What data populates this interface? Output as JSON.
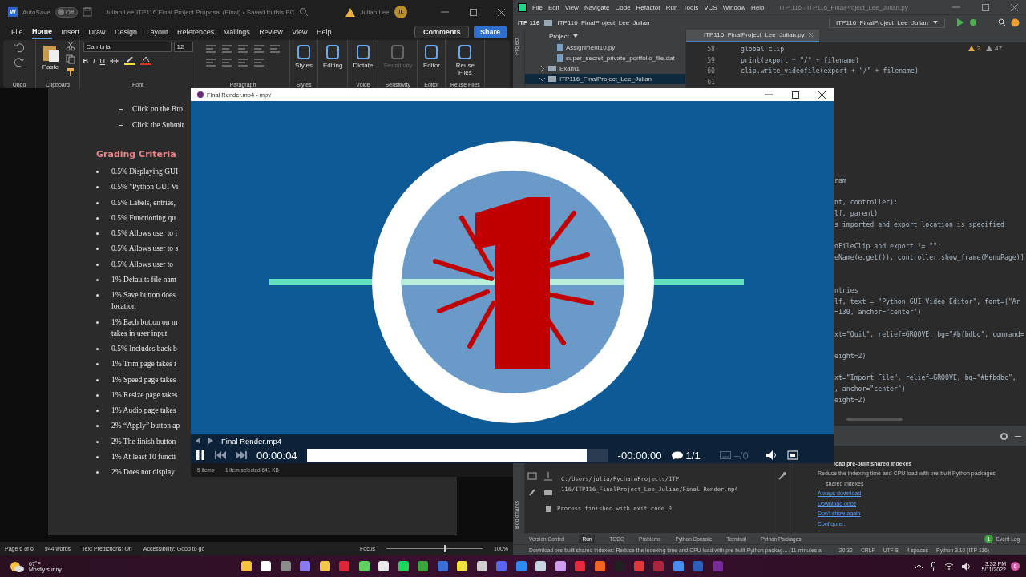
{
  "word": {
    "title_bar": {
      "app_letter": "W",
      "autosave_label": "AutoSave",
      "autosave": {
        "on": false,
        "label": "Off"
      },
      "document_title": "Julian Lee ITP116 Final Project Proposal (Final) • Saved to this PC",
      "user_name": "Julian Lee",
      "avatar_initials": "JL"
    },
    "tabs": [
      {
        "label": "File",
        "selected": false
      },
      {
        "label": "Home",
        "selected": true
      },
      {
        "label": "Insert",
        "selected": false
      },
      {
        "label": "Draw",
        "selected": false
      },
      {
        "label": "Design",
        "selected": false
      },
      {
        "label": "Layout",
        "selected": false
      },
      {
        "label": "References",
        "selected": false
      },
      {
        "label": "Mailings",
        "selected": false
      },
      {
        "label": "Review",
        "selected": false
      },
      {
        "label": "View",
        "selected": false
      },
      {
        "label": "Help",
        "selected": false
      }
    ],
    "comments_button": "Comments",
    "share_button": "Share",
    "ribbon": [
      {
        "kind": "undo",
        "label": "Undo"
      },
      {
        "kind": "clipboard",
        "label": "Clipboard",
        "button": {
          "label": "Paste",
          "disabled": false
        }
      },
      {
        "kind": "font",
        "label": "Font",
        "font_name": "Cambria",
        "font_size": "12",
        "format_buttons": [
          "B",
          "I",
          "U"
        ]
      },
      {
        "kind": "paragraph",
        "label": "Paragraph"
      },
      {
        "kind": "big",
        "label": "Styles",
        "button": {
          "label": "Styles",
          "disabled": false
        }
      },
      {
        "kind": "big",
        "button": {
          "label": "Editing",
          "disabled": false
        }
      },
      {
        "kind": "big",
        "label": "Voice",
        "button": {
          "label": "Dictate",
          "disabled": false
        }
      },
      {
        "kind": "big",
        "label": "Sensitivity",
        "button": {
          "label": "Sensitivity",
          "disabled": true
        }
      },
      {
        "kind": "big",
        "label": "Editor",
        "button": {
          "label": "Editor",
          "disabled": false
        }
      },
      {
        "kind": "big",
        "label": "Reuse Files",
        "button": {
          "label": "Reuse Files",
          "disabled": false
        }
      }
    ],
    "document": {
      "sub_items": [
        "Click on the Bro",
        "Click the Submit"
      ],
      "heading": "Grading Criteria",
      "criteria": [
        {
          "lines": [
            "0.5% Displaying GUI"
          ]
        },
        {
          "lines": [
            "0.5% \"Python GUI Vi"
          ]
        },
        {
          "lines": [
            "0.5% Labels, entries,"
          ]
        },
        {
          "lines": [
            "0.5% Functioning qu"
          ]
        },
        {
          "lines": [
            "0.5% Allows user to i"
          ]
        },
        {
          "lines": [
            "0.5% Allows user to s"
          ]
        },
        {
          "lines": [
            "0.5% Allows user to"
          ]
        },
        {
          "lines": [
            "1% Defaults file nam"
          ]
        },
        {
          "lines": [
            "1% Save button does",
            "location"
          ]
        },
        {
          "lines": [
            "1% Each button on m",
            "takes in user input"
          ]
        },
        {
          "lines": [
            "0.5% Includes back b"
          ]
        },
        {
          "lines": [
            "1% Trim page takes i"
          ]
        },
        {
          "lines": [
            "1% Speed page takes"
          ]
        },
        {
          "lines": [
            "1% Resize page takes"
          ]
        },
        {
          "lines": [
            "1% Audio page takes"
          ]
        },
        {
          "lines": [
            "2% “Apply” button ap"
          ]
        },
        {
          "lines": [
            "2% The finish button"
          ]
        },
        {
          "lines": [
            "1% At least 10 functi"
          ]
        },
        {
          "lines": [
            "2% Does not display"
          ]
        }
      ]
    },
    "status_bar": {
      "page": "Page 6 of 6",
      "words": "944 words",
      "predictions": "Text Predictions: On",
      "accessibility": "Accessibility: Good to go",
      "focus": "Focus",
      "zoom_slider": {
        "level": 0.6
      },
      "zoom": "100%"
    }
  },
  "pycharm": {
    "menu": [
      "File",
      "Edit",
      "View",
      "Navigate",
      "Code",
      "Refactor",
      "Run",
      "Tools",
      "VCS",
      "Window",
      "Help"
    ],
    "title": "ITP 116 - ITP116_FinalProject_Lee_Julian.py",
    "breadcrumb": [
      "ITP 116",
      "ITP116_FinalProject_Lee_Julian"
    ],
    "run_config": "ITP116_FinalProject_Lee_Julian",
    "side_labels": [
      "Project",
      "Bookmarks"
    ],
    "project_panel": {
      "title": "Project",
      "items": [
        {
          "kind": "file",
          "name": "Assignment10.py",
          "selected": false
        },
        {
          "kind": "file",
          "name": "super_secret_private_portfolio_file.dat",
          "selected": false
        },
        {
          "kind": "folder",
          "name": "Exam1",
          "expanded": false,
          "selected": false
        },
        {
          "kind": "folder",
          "name": "ITP116_FinalProject_Lee_Julian",
          "expanded": true,
          "selected": true
        }
      ]
    },
    "editor_tab": "ITP116_FinalProject_Lee_Julian.py",
    "warnings": "2",
    "weak_warnings": "47",
    "code": [
      {
        "kind": "code",
        "number": "58",
        "text": "global clip"
      },
      {
        "kind": "code",
        "number": "59",
        "text": "print(export + \"/\" + filename)"
      },
      {
        "kind": "code",
        "number": "60",
        "text": "clip.write_videofile(export + \"/\" + filename)"
      },
      {
        "kind": "code",
        "number": "61"
      },
      {
        "kind": "blank"
      },
      {
        "kind": "blank"
      },
      {
        "kind": "blank"
      },
      {
        "kind": "blank"
      },
      {
        "kind": "blank"
      },
      {
        "kind": "blank"
      },
      {
        "kind": "blank"
      },
      {
        "kind": "blank"
      },
      {
        "kind": "tail",
        "text": "ram"
      },
      {
        "kind": "blank"
      },
      {
        "kind": "tail",
        "text": "nt, controller):"
      },
      {
        "kind": "tail",
        "text": "lf, parent)"
      },
      {
        "kind": "tail",
        "text": "s imported and export location is specified"
      },
      {
        "kind": "blank"
      },
      {
        "kind": "tail",
        "text": "oFileClip and export != \"\":"
      },
      {
        "kind": "tail",
        "text": "eName(e.get()), controller.show_frame(MenuPage)]"
      },
      {
        "kind": "blank"
      },
      {
        "kind": "blank"
      },
      {
        "kind": "tail",
        "text": "ntries"
      },
      {
        "kind": "tail",
        "text": "lf, text_=_\"Python GUI Video Editor\", font=(\"Ar"
      },
      {
        "kind": "tail",
        "text": "=130, anchor=\"center\")"
      },
      {
        "kind": "blank"
      },
      {
        "kind": "tail",
        "text": "xt=\"Quit\", relief=GROOVE, bg=\"#bfbdbc\", command="
      },
      {
        "kind": "blank"
      },
      {
        "kind": "tail",
        "text": "eight=2)"
      },
      {
        "kind": "blank"
      },
      {
        "kind": "tail",
        "text": "xt=\"Import File\", relief=GROOVE, bg=\"#bfbdbc\","
      },
      {
        "kind": "tail",
        "text": ", anchor=\"center\")"
      },
      {
        "kind": "tail",
        "text": "eight=2)"
      }
    ],
    "run_output": [
      "C:/Users/julia/PycharmProjects/ITP",
      "116/ITP116_FinalProject_Lee_Julian/Final Render.mp4",
      "Process finished with exit code 0"
    ],
    "notification": {
      "title": "load pre-built shared indexes",
      "body": "Reduce the indexing time and CPU load with pre-built Python packages",
      "body_2": "shared indexes",
      "links": [
        "Always download",
        "Download once",
        "Don't show again",
        "Configure..."
      ]
    },
    "tool_tabs": [
      {
        "label": "Version Control",
        "selected": false
      },
      {
        "label": "Run",
        "selected": true
      },
      {
        "label": "TODO",
        "selected": false
      },
      {
        "label": "Problems",
        "selected": false
      },
      {
        "label": "Python Console",
        "selected": false
      },
      {
        "label": "Terminal",
        "selected": false
      },
      {
        "label": "Python Packages",
        "selected": false
      }
    ],
    "event_log": {
      "label": "Event Log",
      "count": "1"
    },
    "status_bar": {
      "message": "Download pre-built shared indexes: Reduce the indexing time and CPU load with pre-built Python packag... (11 minutes a",
      "position": "20:32",
      "line_ending": "CRLF",
      "encoding": "UTF-8",
      "indent": "4 spaces",
      "interpreter": "Python 3.10 (ITP 116)"
    }
  },
  "mpv": {
    "title": "Final Render.mp4 - mpv",
    "filename": "Final Render.mp4",
    "time": "00:00:04",
    "remaining": "-00:00:00",
    "chapters": "1/1",
    "subtitles": "–/0",
    "playing": true,
    "level": 0.93
  },
  "explorer_status": [
    "5 items",
    "1 item selected  641 KB"
  ],
  "taskbar": {
    "temperature": "67°F",
    "weather": "Mostly sunny",
    "time": "3:32 PM",
    "date": "5/11/2022",
    "notifications": "6"
  }
}
